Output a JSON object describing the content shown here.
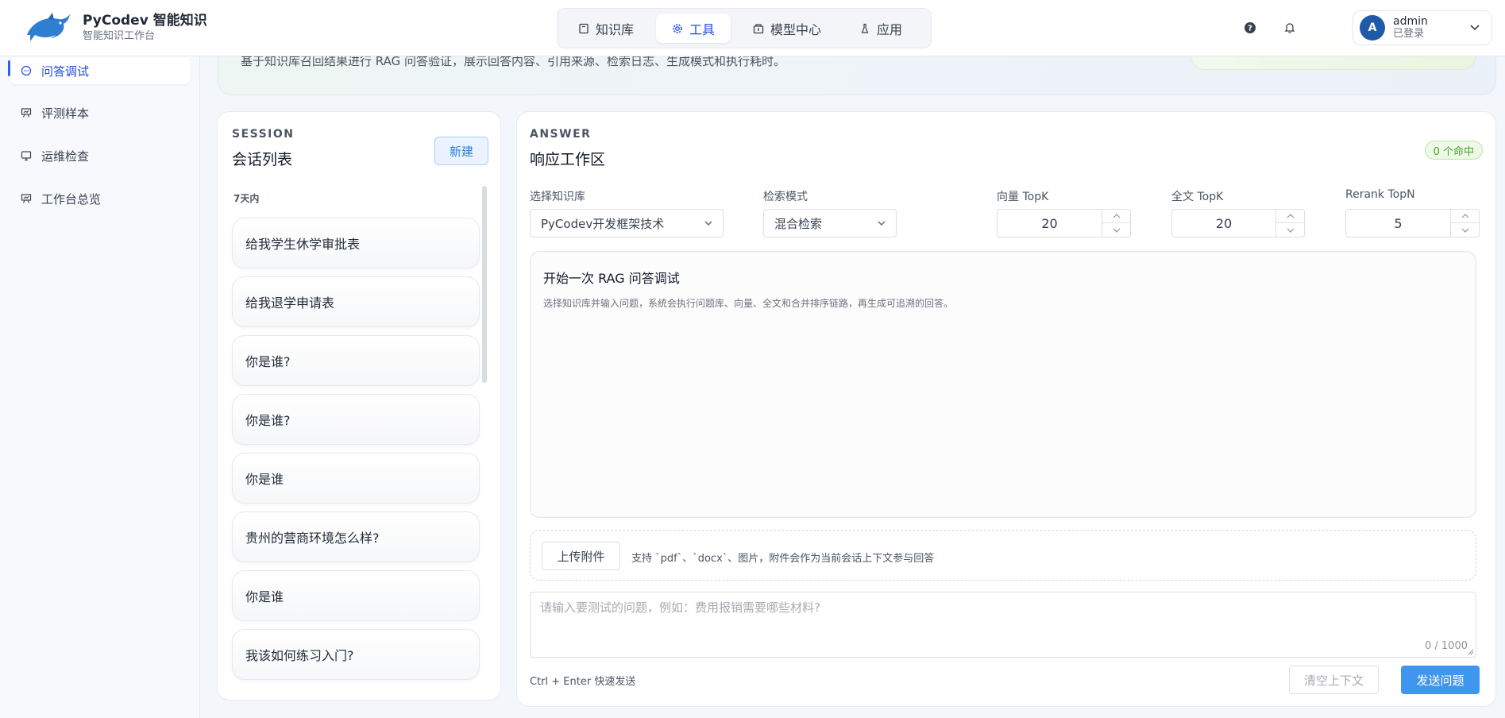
{
  "brand": {
    "title": "PyCodev 智能知识",
    "subtitle": "智能知识工作台"
  },
  "nav": {
    "items": [
      {
        "label": "知识库",
        "icon": "book-icon"
      },
      {
        "label": "工具",
        "icon": "gear-icon",
        "active": true
      },
      {
        "label": "模型中心",
        "icon": "cube-icon"
      },
      {
        "label": "应用",
        "icon": "flask-icon"
      }
    ]
  },
  "header": {
    "help_icon": "question-circle-icon",
    "bell_icon": "bell-icon"
  },
  "user": {
    "avatar": "A",
    "name": "admin",
    "status": "已登录"
  },
  "sidebar": {
    "items": [
      {
        "label": "问答调试",
        "icon": "chat-icon",
        "active": true
      },
      {
        "label": "评测样本",
        "icon": "presentation-icon"
      },
      {
        "label": "运维检查",
        "icon": "monitor-icon"
      },
      {
        "label": "工作台总览",
        "icon": "presentation-icon"
      }
    ]
  },
  "banner": {
    "text": "基于知识库召回结果进行 RAG 问答验证，展示回答内容、引用来源、检索日志、生成模式和执行耗时。"
  },
  "session": {
    "eyebrow": "SESSION",
    "title": "会话列表",
    "new_label": "新建",
    "group_label": "7天内",
    "items": [
      "给我学生休学审批表",
      "给我退学申请表",
      "你是谁?",
      "你是谁?",
      "你是谁",
      "贵州的营商环境怎么样?",
      "你是谁",
      "我该如何练习入门?"
    ]
  },
  "answer": {
    "eyebrow": "ANSWER",
    "title": "响应工作区",
    "hit_badge": "0 个命中",
    "fields": {
      "kb_label": "选择知识库",
      "kb_value": "PyCodev开发框架技术",
      "mode_label": "检索模式",
      "mode_value": "混合检索",
      "vector_label": "向量 TopK",
      "vector_value": "20",
      "fulltext_label": "全文 TopK",
      "fulltext_value": "20",
      "rerank_label": "Rerank TopN",
      "rerank_value": "5"
    },
    "empty_title": "开始一次 RAG 问答调试",
    "empty_desc": "选择知识库并输入问题，系统会执行问题库、向量、全文和合并排序链路，再生成可追溯的回答。",
    "upload_label": "上传附件",
    "upload_hint": "支持 `pdf`、`docx`、图片，附件会作为当前会话上下文参与回答",
    "question_placeholder": "请输入要测试的问题，例如：费用报销需要哪些材料?",
    "char_count": "0 / 1000",
    "shortcut_hint": "Ctrl + Enter 快速发送",
    "clear_label": "清空上下文",
    "send_label": "发送问题"
  },
  "colors": {
    "primary": "#4096ee",
    "nav_active": "#1d4ed8",
    "success": "#4ea12b"
  }
}
